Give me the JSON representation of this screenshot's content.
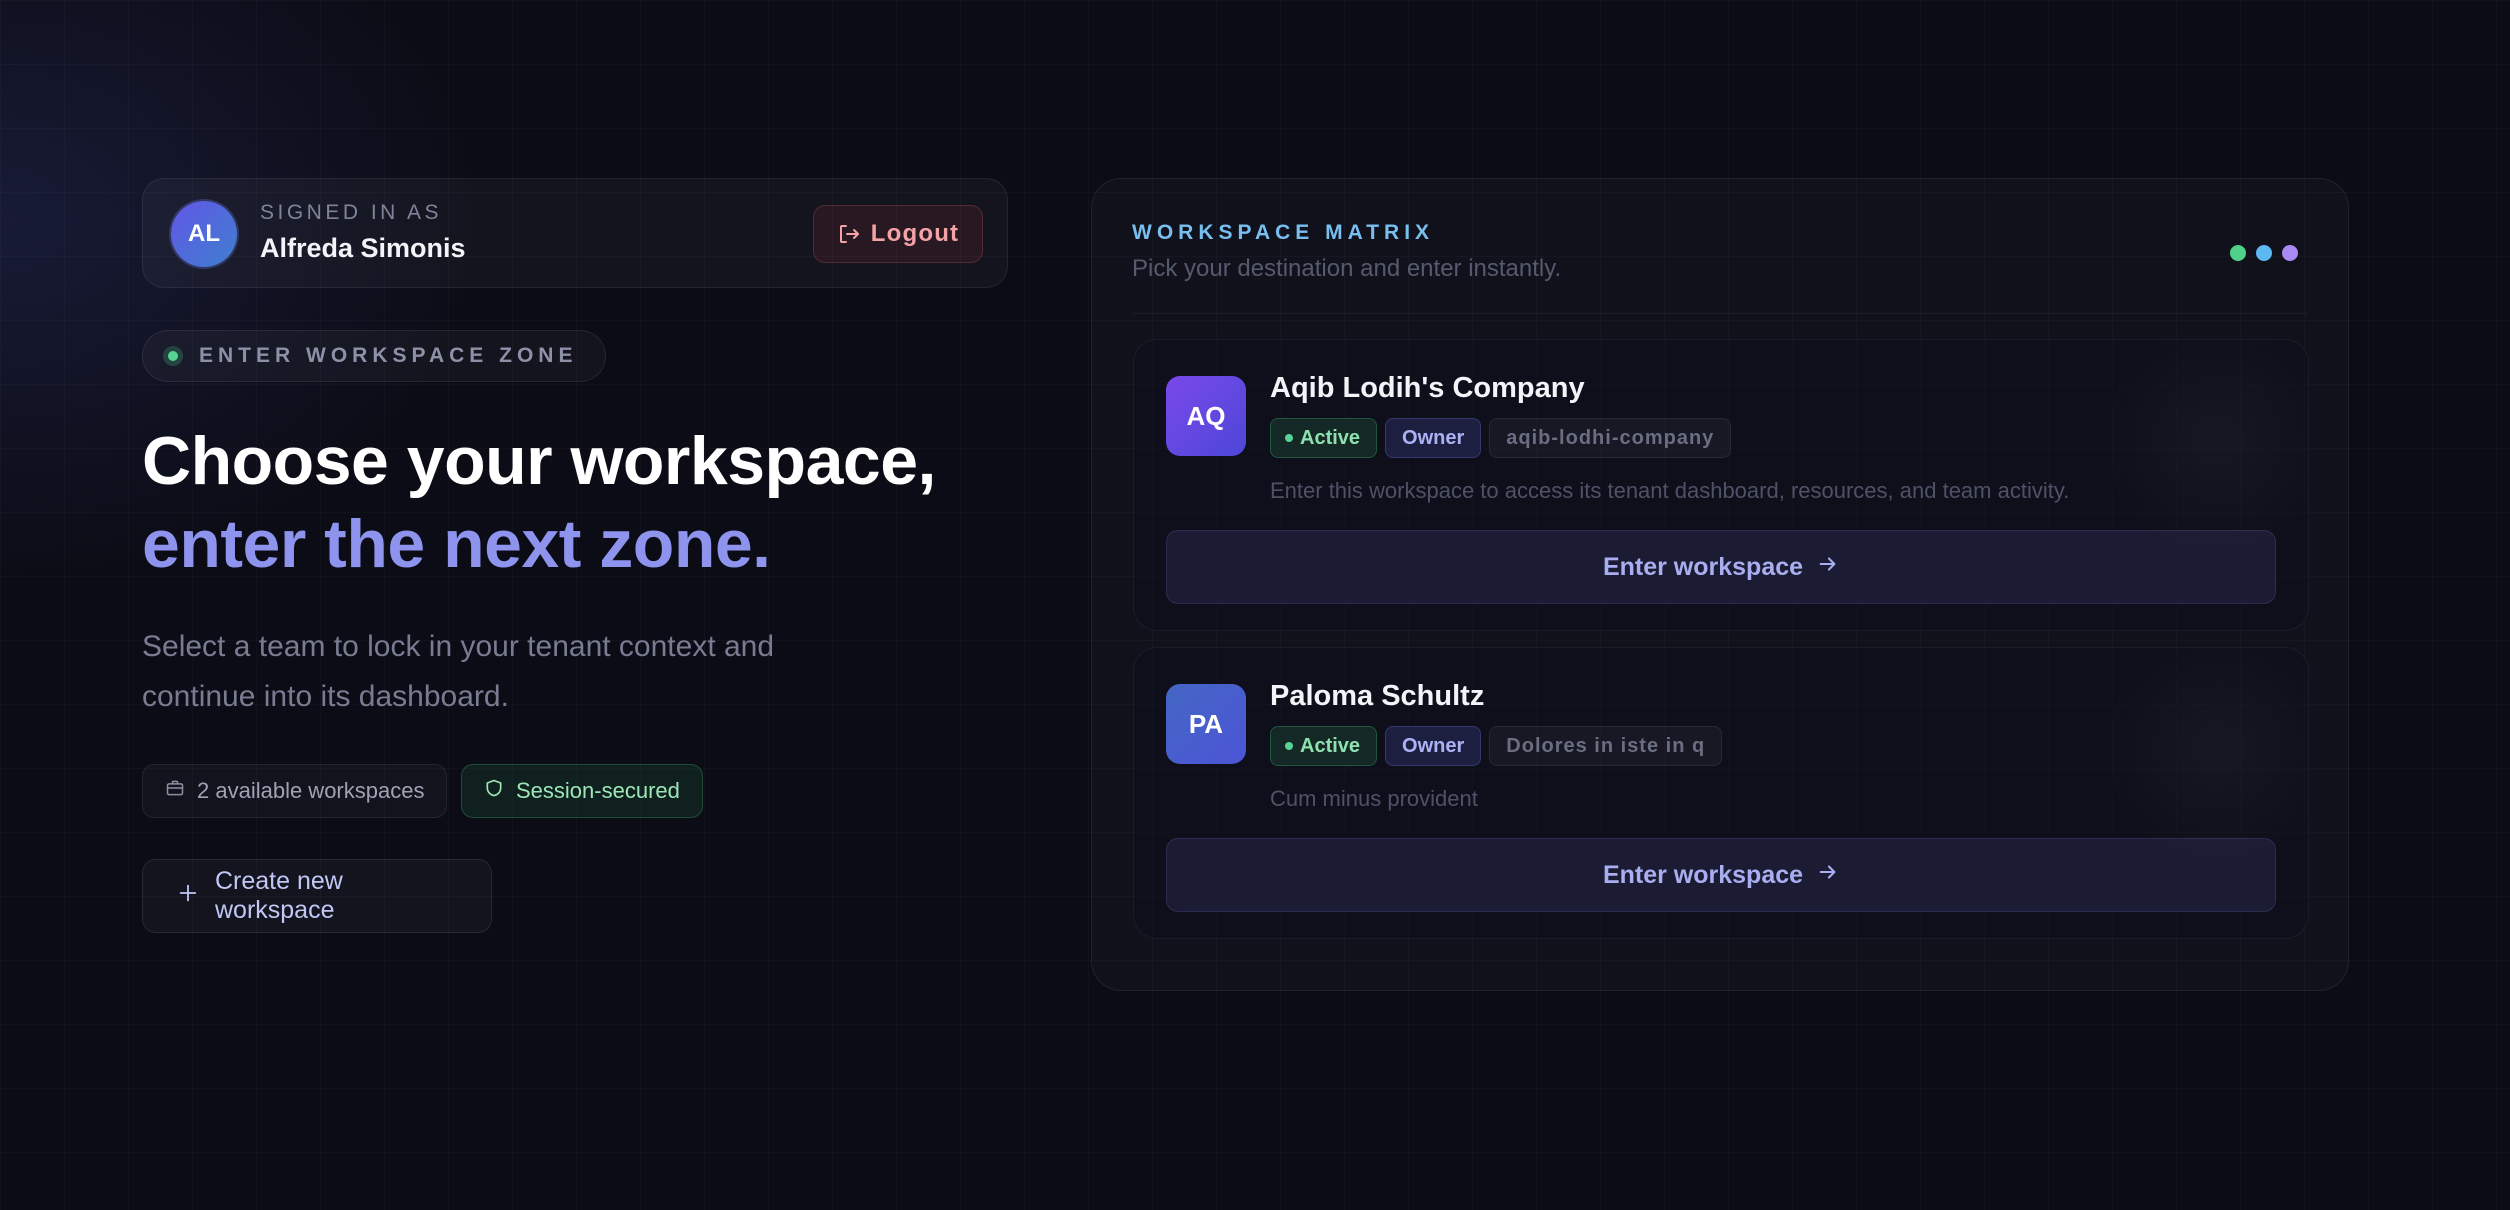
{
  "user": {
    "initials": "AL",
    "signed_in_label": "SIGNED IN AS",
    "name": "Alfreda Simonis",
    "logout_label": "Logout"
  },
  "hero": {
    "zone_label": "ENTER WORKSPACE ZONE",
    "headline_line1": "Choose your workspace,",
    "headline_line2": "enter the next zone.",
    "subtext": "Select a team to lock in your tenant context and continue into its dashboard.",
    "workspace_count_label": "2 available workspaces",
    "session_label": "Session-secured",
    "create_label": "Create new workspace"
  },
  "matrix": {
    "title": "WORKSPACE MATRIX",
    "subtitle": "Pick your destination and enter instantly.",
    "dot_colors": [
      "#4fd18b",
      "#5bb8f0",
      "#a98af2"
    ]
  },
  "workspaces": [
    {
      "initials": "AQ",
      "name": "Aqib Lodih's Company",
      "status": "Active",
      "role": "Owner",
      "slug": "aqib-lodhi-company",
      "description": "Enter this workspace to access its tenant dashboard, resources, and team activity.",
      "enter_label": "Enter workspace",
      "avatar_colors": [
        "#7a48ea",
        "#4d47d8"
      ]
    },
    {
      "initials": "PA",
      "name": "Paloma Schultz",
      "status": "Active",
      "role": "Owner",
      "slug": "Dolores in iste in q",
      "description": "Cum minus provident",
      "enter_label": "Enter workspace",
      "avatar_colors": [
        "#4467c4",
        "#4c54d6"
      ]
    }
  ],
  "colors": {
    "background": "#0b0c15",
    "accent": "#8e93ee",
    "active_green": "#57d394",
    "matrix_title": "#78bff0",
    "logout": "#f3a3a6"
  }
}
